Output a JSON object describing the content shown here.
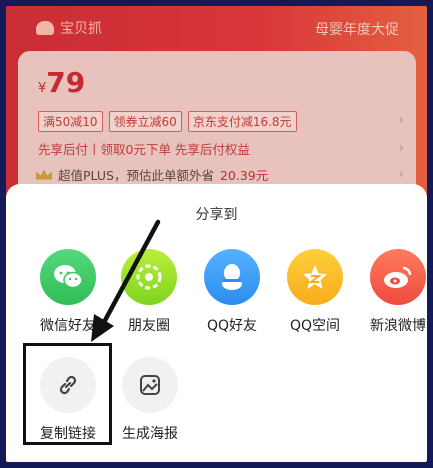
{
  "background_page": {
    "brand": "宝贝抓",
    "banner_right": "母婴年度大促",
    "price_currency": "¥",
    "price_value": "79",
    "coupons": [
      "满50减10",
      "领券立减60",
      "京东支付减16.8元"
    ],
    "bnpl_text": "先享后付丨领取0元下单 先享后付权益",
    "plus_text": "超值PLUS，预估此单额外省",
    "plus_amount": "20.39元"
  },
  "share_sheet": {
    "title": "分享到",
    "row1": [
      {
        "label": "微信好友",
        "icon": "wechat-icon"
      },
      {
        "label": "朋友圈",
        "icon": "moments-icon"
      },
      {
        "label": "QQ好友",
        "icon": "qq-icon"
      },
      {
        "label": "QQ空间",
        "icon": "qzone-icon"
      },
      {
        "label": "新浪微博",
        "icon": "weibo-icon"
      }
    ],
    "row2": [
      {
        "label": "复制链接",
        "icon": "link-icon"
      },
      {
        "label": "生成海报",
        "icon": "image-icon"
      }
    ]
  },
  "colors": {
    "backdrop": "#141a58",
    "page_red": "#d83a32",
    "wechat": "#2fbd58",
    "moments": "#7fd41f",
    "qq": "#2d8cf0",
    "qzone": "#f7ac1d",
    "weibo": "#f04a3e"
  }
}
